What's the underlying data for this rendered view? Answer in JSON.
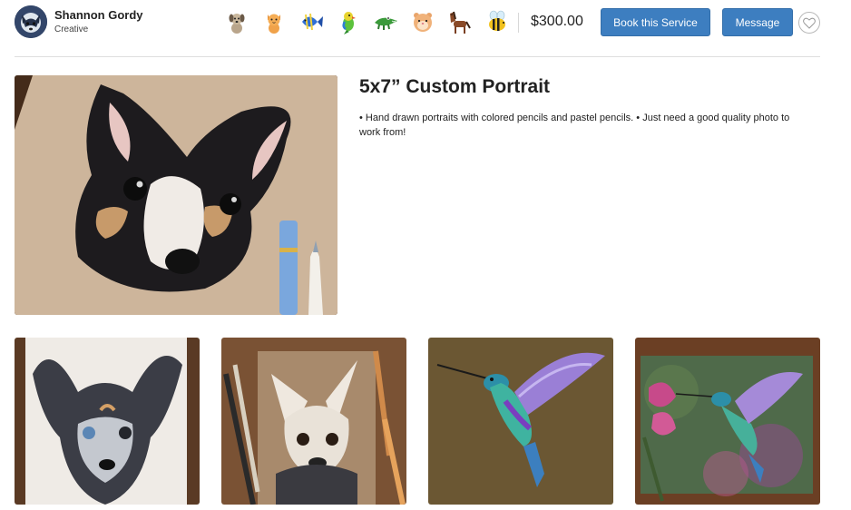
{
  "seller": {
    "name": "Shannon Gordy",
    "role": "Creative"
  },
  "badges": [
    {
      "icon": "dog-icon"
    },
    {
      "icon": "cat-icon"
    },
    {
      "icon": "fish-icon"
    },
    {
      "icon": "parrot-icon"
    },
    {
      "icon": "crocodile-icon"
    },
    {
      "icon": "hamster-icon"
    },
    {
      "icon": "horse-icon"
    },
    {
      "icon": "bee-icon"
    }
  ],
  "price": "$300.00",
  "actions": {
    "book_label": "Book this Service",
    "message_label": "Message",
    "favorite_icon": "heart-icon"
  },
  "listing": {
    "title": "5x7” Custom Portrait",
    "description": "• Hand drawn portraits with colored pencils and pastel pencils. • Just need a good quality photo to work from!"
  },
  "gallery": [
    {
      "subject": "chihuahua-portrait"
    },
    {
      "subject": "dog-drawing-with-pencils"
    },
    {
      "subject": "hummingbird-drawing"
    },
    {
      "subject": "hummingbird-flower-drawing"
    }
  ],
  "colors": {
    "primary_button": "#3d7ec0",
    "text": "#222222",
    "divider": "#dedede"
  }
}
